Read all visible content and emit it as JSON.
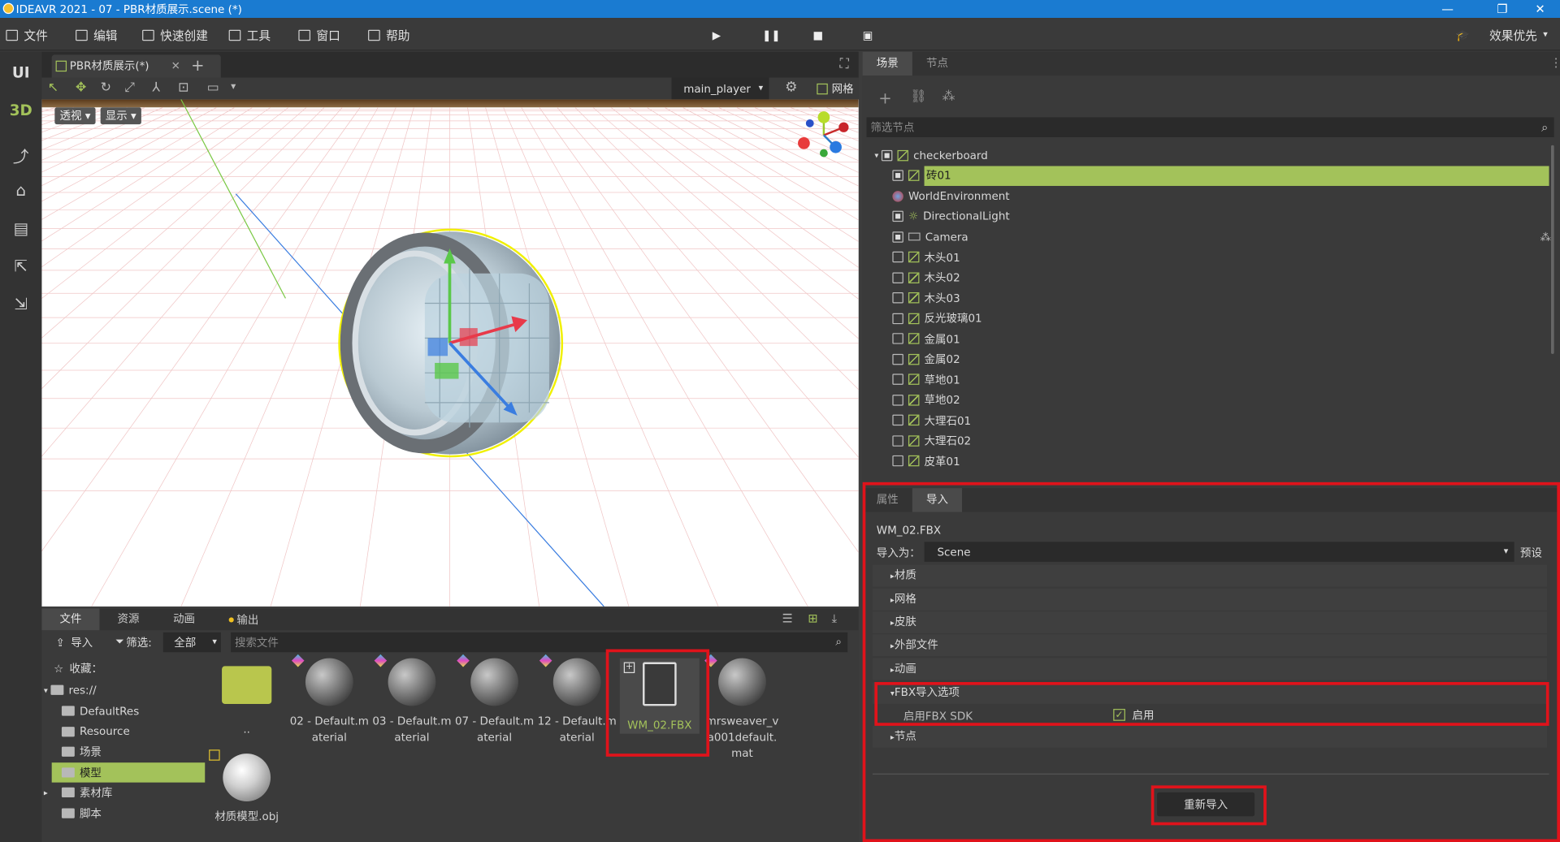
{
  "titlebar": {
    "title": "IDEAVR 2021 - 07 - PBR材质展示.scene (*)"
  },
  "menu": {
    "items": [
      "文件",
      "编辑",
      "快速创建",
      "工具",
      "窗口",
      "帮助"
    ],
    "quality": "效果优先"
  },
  "lefttoolbar": {
    "ui": "UI",
    "threed": "3D"
  },
  "viewport": {
    "tab": "PBR材质展示(*)",
    "player": "main_player",
    "grid_label": "网格",
    "view_mode": "透视",
    "display": "显示"
  },
  "scene": {
    "tabs": [
      "场景",
      "节点"
    ],
    "filter_placeholder": "筛选节点",
    "nodes": [
      {
        "name": "checkerboard"
      },
      {
        "name": "砖01"
      },
      {
        "name": "WorldEnvironment"
      },
      {
        "name": "DirectionalLight"
      },
      {
        "name": "Camera"
      },
      {
        "name": "木头01"
      },
      {
        "name": "木头02"
      },
      {
        "name": "木头03"
      },
      {
        "name": "反光玻璃01"
      },
      {
        "name": "金属01"
      },
      {
        "name": "金属02"
      },
      {
        "name": "草地01"
      },
      {
        "name": "草地02"
      },
      {
        "name": "大理石01"
      },
      {
        "name": "大理石02"
      },
      {
        "name": "皮革01"
      }
    ]
  },
  "inspector": {
    "tabs": [
      "属性",
      "导入"
    ],
    "filename": "WM_02.FBX",
    "import_as_label": "导入为：",
    "import_as_value": "Scene",
    "preset": "预设",
    "sections": [
      "材质",
      "网格",
      "皮肤",
      "外部文件",
      "动画",
      "FBX导入选项",
      "节点"
    ],
    "fbx_sdk_label": "启用FBX SDK",
    "fbx_sdk_value": "启用",
    "reimport": "重新导入"
  },
  "files": {
    "tabs": [
      "文件",
      "资源",
      "动画",
      "输出"
    ],
    "import": "导入",
    "filter": "筛选:",
    "filter_value": "全部",
    "search_placeholder": "搜索文件",
    "favorites": "收藏：",
    "root": "res://",
    "folders": [
      "DefaultRes",
      "Resource",
      "场景",
      "模型",
      "素材库",
      "脚本"
    ],
    "assets": [
      "..",
      "02 - Default.material",
      "03 - Default.material",
      "07 - Default.material",
      "12 - Default.material",
      "WM_02.FBX",
      "mrsweaver_va001default.mat",
      "材质模型.obj"
    ]
  }
}
